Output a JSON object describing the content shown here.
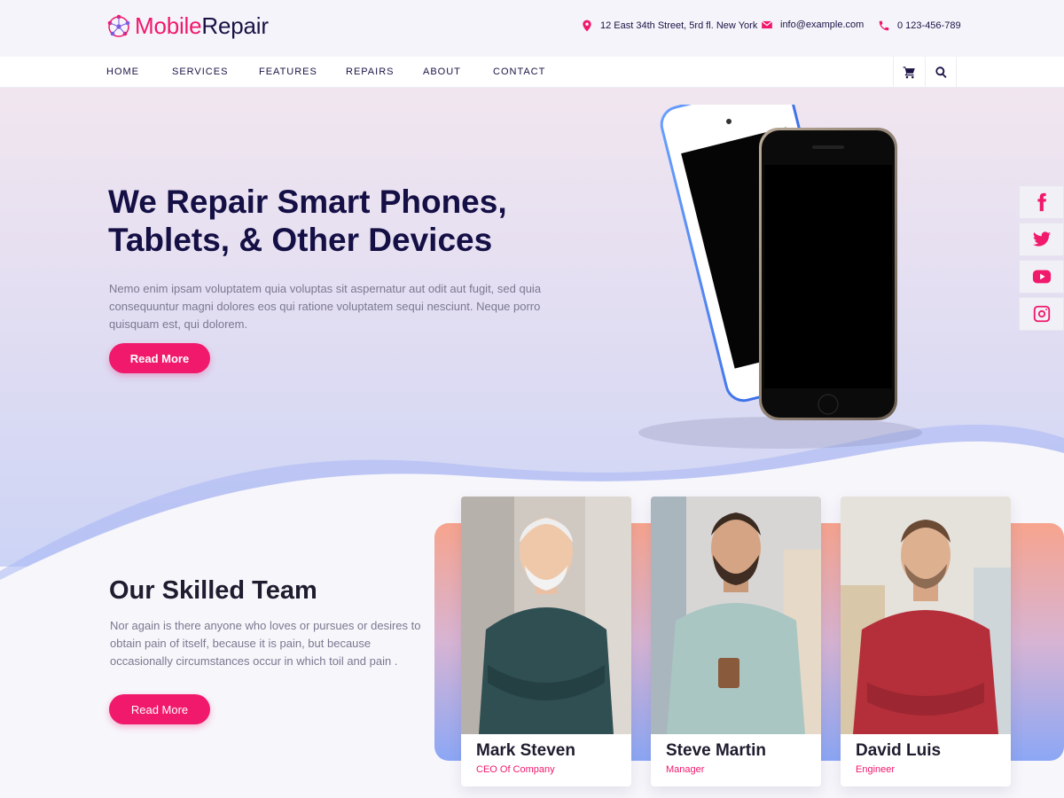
{
  "brand": {
    "part1": "Mobile",
    "part2": "Repair"
  },
  "contact": {
    "address": "12 East 34th Street, 5rd fl. New York",
    "email": "info@example.com",
    "phone": "0 123-456-789"
  },
  "nav": {
    "items": [
      {
        "label": "HOME"
      },
      {
        "label": "SERVICES"
      },
      {
        "label": "FEATURES"
      },
      {
        "label": "REPAIRS"
      },
      {
        "label": "ABOUT"
      },
      {
        "label": "CONTACT"
      }
    ]
  },
  "hero": {
    "title_line1": "We Repair Smart Phones,",
    "title_line2": "Tablets, & Other Devices",
    "text": "Nemo enim ipsam voluptatem quia voluptas sit aspernatur aut odit aut fugit, sed quia consequuntur magni dolores eos qui ratione voluptatem sequi nesciunt. Neque porro quisquam est, qui dolorem.",
    "button": "Read  More"
  },
  "social": [
    "facebook-icon",
    "twitter-icon",
    "youtube-icon",
    "instagram-icon"
  ],
  "team": {
    "title": "Our Skilled Team",
    "text": "Nor again is there anyone who loves or pursues or desires to obtain pain of itself, because it is pain, but because occasionally circumstances occur in which toil and pain .",
    "button": "Read More",
    "members": [
      {
        "name": "Mark Steven",
        "role": "CEO Of Company"
      },
      {
        "name": "Steve Martin",
        "role": "Manager"
      },
      {
        "name": "David Luis",
        "role": "Engineer"
      }
    ]
  },
  "colors": {
    "accent": "#f0196c",
    "navy": "#140f45",
    "muted": "#7b7890"
  }
}
